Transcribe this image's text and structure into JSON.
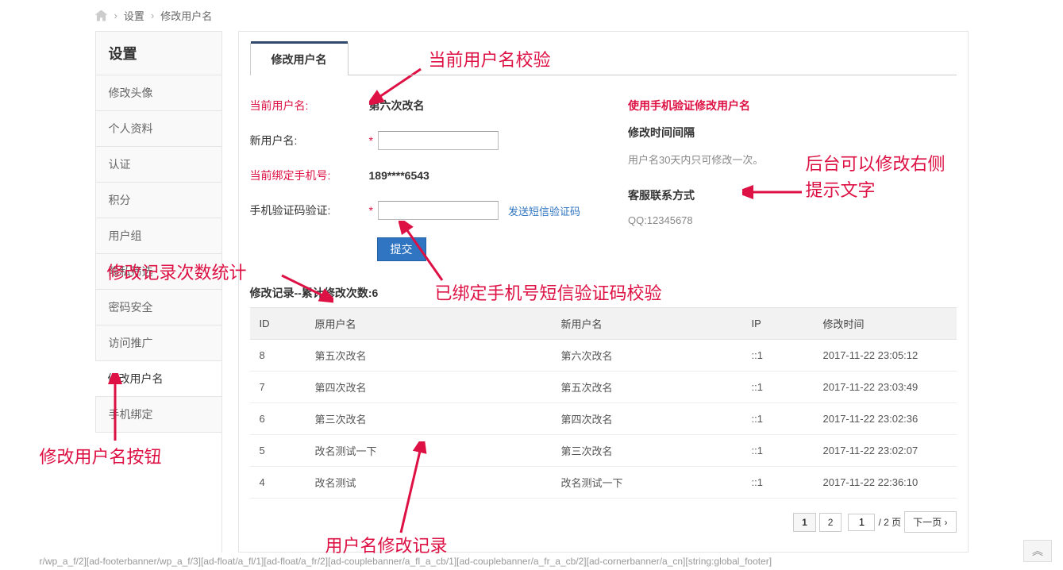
{
  "breadcrumb": {
    "settings": "设置",
    "current": "修改用户名"
  },
  "sidebar": {
    "title": "设置",
    "items": [
      {
        "label": "修改头像"
      },
      {
        "label": "个人资料"
      },
      {
        "label": "认证"
      },
      {
        "label": "积分"
      },
      {
        "label": "用户组"
      },
      {
        "label": "隐私筛选"
      },
      {
        "label": "密码安全"
      },
      {
        "label": "访问推广"
      },
      {
        "label": "修改用户名"
      },
      {
        "label": "手机绑定"
      }
    ]
  },
  "tab": {
    "label": "修改用户名"
  },
  "form": {
    "current_user_label": "当前用户名:",
    "current_user_value": "第六次改名",
    "new_user_label": "新用户名:",
    "phone_label": "当前绑定手机号:",
    "phone_value": "189****6543",
    "sms_label": "手机验证码验证:",
    "sms_link": "发送短信验证码",
    "submit": "提交"
  },
  "tips": {
    "title": "使用手机验证修改用户名",
    "interval_label": "修改时间间隔",
    "interval_text": "用户名30天内只可修改一次。",
    "service_label": "客服联系方式",
    "service_text": "QQ:12345678"
  },
  "history": {
    "title": "修改记录--累计修改次数:6",
    "cols": {
      "id": "ID",
      "old": "原用户名",
      "new": "新用户名",
      "ip": "IP",
      "time": "修改时间"
    },
    "rows": [
      {
        "id": "8",
        "old": "第五次改名",
        "new": "第六次改名",
        "ip": "::1",
        "time": "2017-11-22 23:05:12"
      },
      {
        "id": "7",
        "old": "第四次改名",
        "new": "第五次改名",
        "ip": "::1",
        "time": "2017-11-22 23:03:49"
      },
      {
        "id": "6",
        "old": "第三次改名",
        "new": "第四次改名",
        "ip": "::1",
        "time": "2017-11-22 23:02:36"
      },
      {
        "id": "5",
        "old": "改名测试一下",
        "new": "第三次改名",
        "ip": "::1",
        "time": "2017-11-22 23:02:07"
      },
      {
        "id": "4",
        "old": "改名测试",
        "new": "改名测试一下",
        "ip": "::1",
        "time": "2017-11-22 22:36:10"
      }
    ]
  },
  "pager": {
    "p1": "1",
    "p2": "2",
    "input": "1",
    "total": "/ 2 页",
    "next": "下一页"
  },
  "annotations": {
    "a1": "当前用户名校验",
    "a2": "后台可以修改右侧提示文字",
    "a3": "修改记录次数统计",
    "a4": "已绑定手机号短信验证码校验",
    "a5": "修改用户名按钮",
    "a6": "用户名修改记录"
  },
  "footer": "r/wp_a_f/2][ad-footerbanner/wp_a_f/3][ad-float/a_fl/1][ad-float/a_fr/2][ad-couplebanner/a_fl_a_cb/1][ad-couplebanner/a_fr_a_cb/2][ad-cornerbanner/a_cn][string:global_footer]"
}
